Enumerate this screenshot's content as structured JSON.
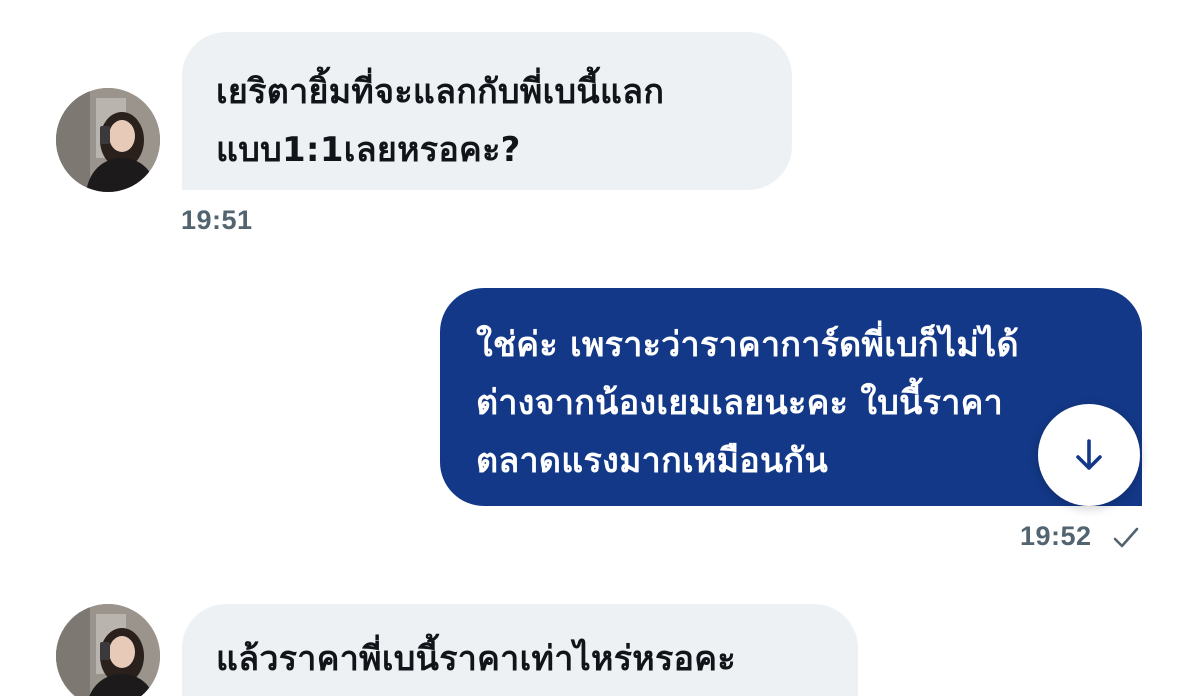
{
  "colors": {
    "incoming_bubble": "#eef1f4",
    "outgoing_bubble": "#133887",
    "timestamp": "#536471",
    "accent": "#133887"
  },
  "messages": [
    {
      "direction": "incoming",
      "text": "เยริตายิ้มที่จะแลกกับพี่เบนี้แลก\nแบบ1:1เลยหรอคะ?",
      "time": "19:51",
      "avatar_icon": "user-photo-avatar"
    },
    {
      "direction": "outgoing",
      "text": "ใช่ค่ะ เพราะว่าราคาการ์ดพี่เบก็ไม่ได้\nต่างจากน้องเยมเลยนะคะ ใบนี้ราคา\nตลาดแรงมากเหมือนกัน",
      "time": "19:52",
      "status_icon": "read-check-icon"
    },
    {
      "direction": "incoming",
      "text": "แล้วราคาพี่เบนี้ราคาเท่าไหร่หรอคะ",
      "avatar_icon": "user-photo-avatar"
    }
  ],
  "scroll_button_icon": "arrow-down-icon"
}
